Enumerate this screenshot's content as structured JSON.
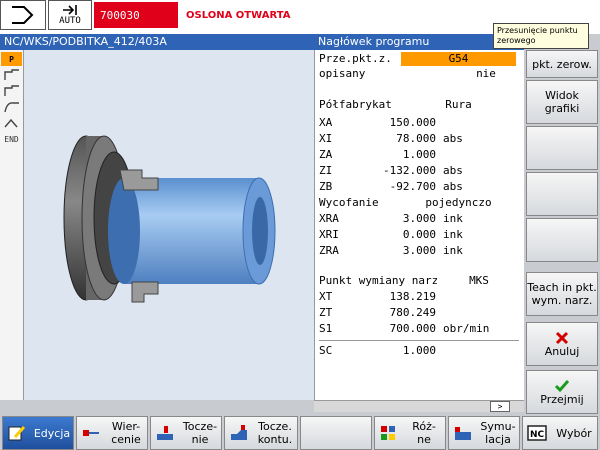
{
  "topbar": {
    "mode_icon": "jog-arrow-icon",
    "auto_label": "AUTO",
    "alarm_number": "700030",
    "alarm_text": "OSLONA OTWARTA"
  },
  "tooltip": "Przesunięcie punktu zerowego",
  "titlebar": {
    "path": "NC/WKS/PODBITKA_412/403A",
    "header": "Nagłówek programu"
  },
  "leftstrip": {
    "items": [
      "P",
      "",
      "",
      "",
      "",
      "END"
    ]
  },
  "params": {
    "rows": [
      {
        "label": "Prze.pkt.z.",
        "value": "G54",
        "unit": ""
      },
      {
        "label": "opisany",
        "value": "nie",
        "unit": ""
      },
      {
        "label": "Półfabrykat",
        "value": "Rura",
        "unit": ""
      },
      {
        "label": "XA",
        "value": "150.000",
        "unit": ""
      },
      {
        "label": "XI",
        "value": "78.000",
        "unit": "abs"
      },
      {
        "label": "ZA",
        "value": "1.000",
        "unit": ""
      },
      {
        "label": "ZI",
        "value": "-132.000",
        "unit": "abs"
      },
      {
        "label": "ZB",
        "value": "-92.700",
        "unit": "abs"
      },
      {
        "label": "Wycofanie",
        "value": "pojedynczo",
        "unit": ""
      },
      {
        "label": "XRA",
        "value": "3.000",
        "unit": "ink"
      },
      {
        "label": "XRI",
        "value": "0.000",
        "unit": "ink"
      },
      {
        "label": "ZRA",
        "value": "3.000",
        "unit": "ink"
      },
      {
        "label": "Punkt wymiany narz.",
        "value": "MKS",
        "unit": ""
      },
      {
        "label": "XT",
        "value": "138.219",
        "unit": ""
      },
      {
        "label": "ZT",
        "value": "780.249",
        "unit": ""
      },
      {
        "label": "S1",
        "value": "700.000",
        "unit": "obr/min"
      },
      {
        "label": "SC",
        "value": "1.000",
        "unit": ""
      }
    ]
  },
  "scroll_arrow": ">",
  "vertical_softkeys": [
    {
      "label": "pkt. zerow."
    },
    {
      "label": "Widok\ngrafiki"
    },
    {
      "label": ""
    },
    {
      "label": ""
    },
    {
      "label": ""
    },
    {
      "label": "Teach in pkt.\nwym. narz."
    },
    {
      "label": "Anuluj",
      "icon": "cancel-x-icon"
    },
    {
      "label": "Przejmij",
      "icon": "accept-check-icon"
    }
  ],
  "horizontal_softkeys": [
    {
      "label": "Edycja",
      "icon": "edit-icon"
    },
    {
      "label": "Wier-\ncenie",
      "icon": "drilling-icon"
    },
    {
      "label": "Tocze-\nnie",
      "icon": "turning-icon"
    },
    {
      "label": "Tocze.\nkontu.",
      "icon": "contour-turning-icon"
    },
    {
      "label": ""
    },
    {
      "label": "Róż-\nne",
      "icon": "misc-icon"
    },
    {
      "label": "Symu-\nlacja",
      "icon": "simulation-icon"
    },
    {
      "label": "Wybór",
      "icon": "nc-select-icon"
    }
  ],
  "colors": {
    "title_blue": "#2e63b6",
    "alarm_red": "#e0001a",
    "select_orange": "#ff9900",
    "part_blue": "#7fb0e6"
  }
}
